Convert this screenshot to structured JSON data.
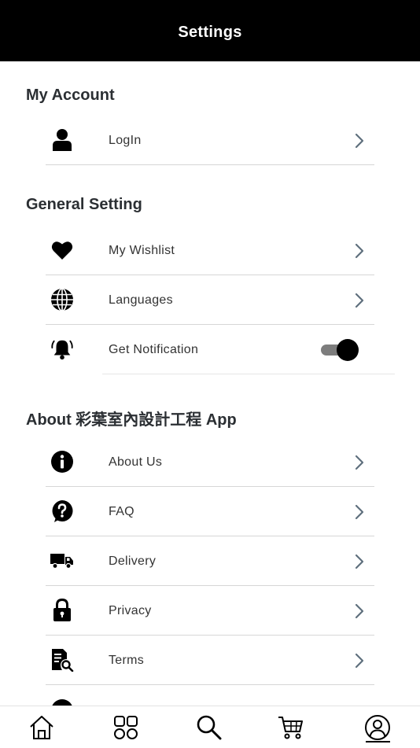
{
  "header": {
    "title": "Settings"
  },
  "sections": {
    "account": {
      "title": "My Account"
    },
    "general": {
      "title": "General Setting"
    },
    "about": {
      "title": "About 彩葉室內設計工程 App"
    }
  },
  "rows": {
    "login": {
      "label": "LogIn",
      "icon": "user-icon"
    },
    "wishlist": {
      "label": "My Wishlist",
      "icon": "heart-icon"
    },
    "languages": {
      "label": "Languages",
      "icon": "globe-icon"
    },
    "notification": {
      "label": "Get Notification",
      "icon": "bell-icon",
      "enabled": true
    },
    "about_us": {
      "label": "About Us",
      "icon": "info-icon"
    },
    "faq": {
      "label": "FAQ",
      "icon": "question-icon"
    },
    "delivery": {
      "label": "Delivery",
      "icon": "truck-icon"
    },
    "privacy": {
      "label": "Privacy",
      "icon": "lock-icon"
    },
    "terms": {
      "label": "Terms",
      "icon": "document-search-icon"
    }
  },
  "bottom_nav": {
    "items": [
      {
        "icon": "home-icon"
      },
      {
        "icon": "grid-icon"
      },
      {
        "icon": "search-icon"
      },
      {
        "icon": "cart-icon"
      },
      {
        "icon": "profile-icon",
        "active": true
      }
    ]
  },
  "colors": {
    "header_bg": "#000000",
    "divider": "#d6d6d6",
    "chevron": "#5f6f7d",
    "toggle_track": "#7d7d7d"
  }
}
